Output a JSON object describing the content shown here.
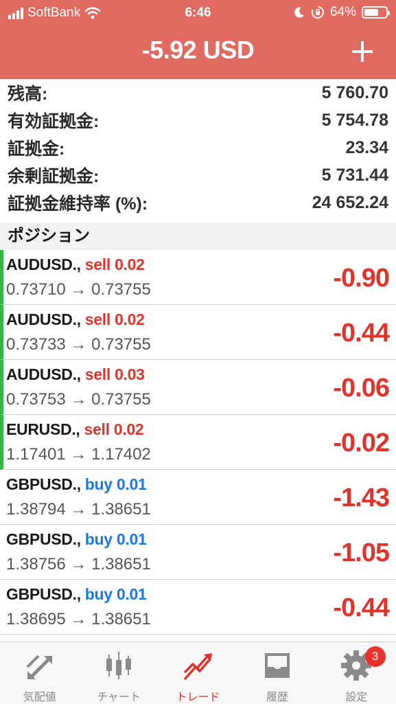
{
  "status_bar": {
    "carrier": "SoftBank",
    "time": "6:46",
    "battery": "64%"
  },
  "header": {
    "title": "-5.92 USD"
  },
  "summary": [
    {
      "label": "残高:",
      "value": "5 760.70"
    },
    {
      "label": "有効証拠金:",
      "value": "5 754.78"
    },
    {
      "label": "証拠金:",
      "value": "23.34"
    },
    {
      "label": "余剰証拠金:",
      "value": "5 731.44"
    },
    {
      "label": "証拠金維持率 (%):",
      "value": "24 652.24"
    }
  ],
  "section_title": "ポジション",
  "positions": [
    {
      "symbol": "AUDUSD.,",
      "side": "sell 0.02",
      "prices": "0.73710 → 0.73755",
      "profit": "-0.90"
    },
    {
      "symbol": "AUDUSD.,",
      "side": "sell 0.02",
      "prices": "0.73733 → 0.73755",
      "profit": "-0.44"
    },
    {
      "symbol": "AUDUSD.,",
      "side": "sell 0.03",
      "prices": "0.73753 → 0.73755",
      "profit": "-0.06"
    },
    {
      "symbol": "EURUSD.,",
      "side": "sell 0.02",
      "prices": "1.17401 → 1.17402",
      "profit": "-0.02"
    },
    {
      "symbol": "GBPUSD.,",
      "side": "buy 0.01",
      "prices": "1.38794 → 1.38651",
      "profit": "-1.43"
    },
    {
      "symbol": "GBPUSD.,",
      "side": "buy 0.01",
      "prices": "1.38756 → 1.38651",
      "profit": "-1.05"
    },
    {
      "symbol": "GBPUSD.,",
      "side": "buy 0.01",
      "prices": "1.38695 → 1.38651",
      "profit": "-0.44"
    }
  ],
  "tabs": [
    {
      "label": "気配値",
      "icon": "quotes-arrows-icon"
    },
    {
      "label": "チャート",
      "icon": "candlestick-icon"
    },
    {
      "label": "トレード",
      "icon": "trade-trend-icon",
      "active": true
    },
    {
      "label": "履歴",
      "icon": "inbox-history-icon"
    },
    {
      "label": "設定",
      "icon": "gear-icon",
      "badge": "3"
    }
  ],
  "colors": {
    "header_bg": "#e06a60",
    "sell": "#e0332c",
    "buy": "#1a78e8",
    "loss": "#e0332c",
    "position_marker": "#34b64a",
    "tab_active": "#e0332c"
  }
}
